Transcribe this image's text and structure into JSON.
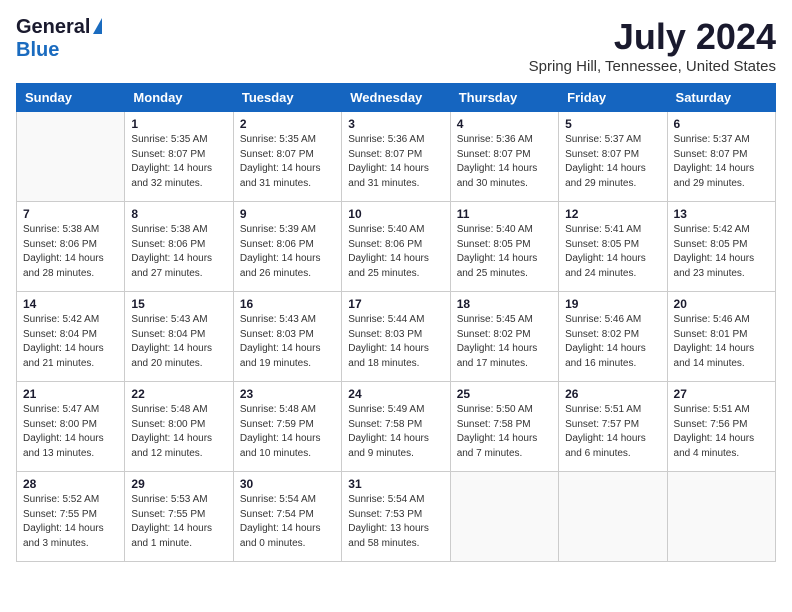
{
  "header": {
    "logo_general": "General",
    "logo_blue": "Blue",
    "month_title": "July 2024",
    "location": "Spring Hill, Tennessee, United States"
  },
  "weekdays": [
    "Sunday",
    "Monday",
    "Tuesday",
    "Wednesday",
    "Thursday",
    "Friday",
    "Saturday"
  ],
  "weeks": [
    [
      {
        "day": "",
        "info": ""
      },
      {
        "day": "1",
        "info": "Sunrise: 5:35 AM\nSunset: 8:07 PM\nDaylight: 14 hours\nand 32 minutes."
      },
      {
        "day": "2",
        "info": "Sunrise: 5:35 AM\nSunset: 8:07 PM\nDaylight: 14 hours\nand 31 minutes."
      },
      {
        "day": "3",
        "info": "Sunrise: 5:36 AM\nSunset: 8:07 PM\nDaylight: 14 hours\nand 31 minutes."
      },
      {
        "day": "4",
        "info": "Sunrise: 5:36 AM\nSunset: 8:07 PM\nDaylight: 14 hours\nand 30 minutes."
      },
      {
        "day": "5",
        "info": "Sunrise: 5:37 AM\nSunset: 8:07 PM\nDaylight: 14 hours\nand 29 minutes."
      },
      {
        "day": "6",
        "info": "Sunrise: 5:37 AM\nSunset: 8:07 PM\nDaylight: 14 hours\nand 29 minutes."
      }
    ],
    [
      {
        "day": "7",
        "info": "Sunrise: 5:38 AM\nSunset: 8:06 PM\nDaylight: 14 hours\nand 28 minutes."
      },
      {
        "day": "8",
        "info": "Sunrise: 5:38 AM\nSunset: 8:06 PM\nDaylight: 14 hours\nand 27 minutes."
      },
      {
        "day": "9",
        "info": "Sunrise: 5:39 AM\nSunset: 8:06 PM\nDaylight: 14 hours\nand 26 minutes."
      },
      {
        "day": "10",
        "info": "Sunrise: 5:40 AM\nSunset: 8:06 PM\nDaylight: 14 hours\nand 25 minutes."
      },
      {
        "day": "11",
        "info": "Sunrise: 5:40 AM\nSunset: 8:05 PM\nDaylight: 14 hours\nand 25 minutes."
      },
      {
        "day": "12",
        "info": "Sunrise: 5:41 AM\nSunset: 8:05 PM\nDaylight: 14 hours\nand 24 minutes."
      },
      {
        "day": "13",
        "info": "Sunrise: 5:42 AM\nSunset: 8:05 PM\nDaylight: 14 hours\nand 23 minutes."
      }
    ],
    [
      {
        "day": "14",
        "info": "Sunrise: 5:42 AM\nSunset: 8:04 PM\nDaylight: 14 hours\nand 21 minutes."
      },
      {
        "day": "15",
        "info": "Sunrise: 5:43 AM\nSunset: 8:04 PM\nDaylight: 14 hours\nand 20 minutes."
      },
      {
        "day": "16",
        "info": "Sunrise: 5:43 AM\nSunset: 8:03 PM\nDaylight: 14 hours\nand 19 minutes."
      },
      {
        "day": "17",
        "info": "Sunrise: 5:44 AM\nSunset: 8:03 PM\nDaylight: 14 hours\nand 18 minutes."
      },
      {
        "day": "18",
        "info": "Sunrise: 5:45 AM\nSunset: 8:02 PM\nDaylight: 14 hours\nand 17 minutes."
      },
      {
        "day": "19",
        "info": "Sunrise: 5:46 AM\nSunset: 8:02 PM\nDaylight: 14 hours\nand 16 minutes."
      },
      {
        "day": "20",
        "info": "Sunrise: 5:46 AM\nSunset: 8:01 PM\nDaylight: 14 hours\nand 14 minutes."
      }
    ],
    [
      {
        "day": "21",
        "info": "Sunrise: 5:47 AM\nSunset: 8:00 PM\nDaylight: 14 hours\nand 13 minutes."
      },
      {
        "day": "22",
        "info": "Sunrise: 5:48 AM\nSunset: 8:00 PM\nDaylight: 14 hours\nand 12 minutes."
      },
      {
        "day": "23",
        "info": "Sunrise: 5:48 AM\nSunset: 7:59 PM\nDaylight: 14 hours\nand 10 minutes."
      },
      {
        "day": "24",
        "info": "Sunrise: 5:49 AM\nSunset: 7:58 PM\nDaylight: 14 hours\nand 9 minutes."
      },
      {
        "day": "25",
        "info": "Sunrise: 5:50 AM\nSunset: 7:58 PM\nDaylight: 14 hours\nand 7 minutes."
      },
      {
        "day": "26",
        "info": "Sunrise: 5:51 AM\nSunset: 7:57 PM\nDaylight: 14 hours\nand 6 minutes."
      },
      {
        "day": "27",
        "info": "Sunrise: 5:51 AM\nSunset: 7:56 PM\nDaylight: 14 hours\nand 4 minutes."
      }
    ],
    [
      {
        "day": "28",
        "info": "Sunrise: 5:52 AM\nSunset: 7:55 PM\nDaylight: 14 hours\nand 3 minutes."
      },
      {
        "day": "29",
        "info": "Sunrise: 5:53 AM\nSunset: 7:55 PM\nDaylight: 14 hours\nand 1 minute."
      },
      {
        "day": "30",
        "info": "Sunrise: 5:54 AM\nSunset: 7:54 PM\nDaylight: 14 hours\nand 0 minutes."
      },
      {
        "day": "31",
        "info": "Sunrise: 5:54 AM\nSunset: 7:53 PM\nDaylight: 13 hours\nand 58 minutes."
      },
      {
        "day": "",
        "info": ""
      },
      {
        "day": "",
        "info": ""
      },
      {
        "day": "",
        "info": ""
      }
    ]
  ]
}
